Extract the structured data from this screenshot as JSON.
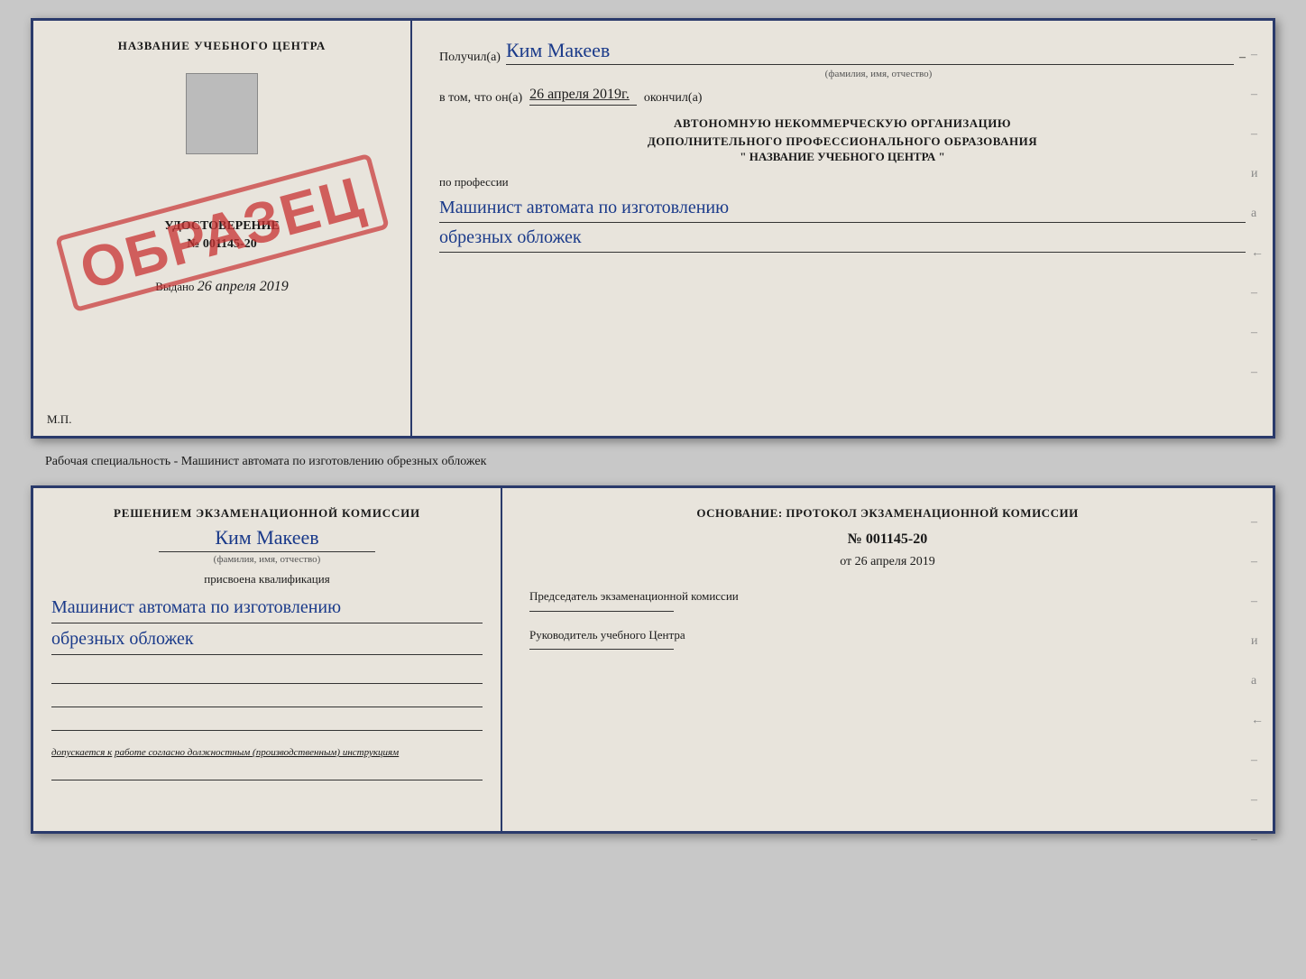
{
  "top_doc": {
    "left": {
      "training_center": "НАЗВАНИЕ УЧЕБНОГО ЦЕНТРА",
      "stamp_text": "ОБРАЗЕЦ",
      "certificate_label": "УДОСТОВЕРЕНИЕ",
      "cert_number": "№ 001145-20",
      "vydano_label": "Выдано",
      "vydano_date": "26 апреля 2019",
      "mp_label": "М.П."
    },
    "right": {
      "poluchil_label": "Получил(а)",
      "recipient_name": "Ким Макеев",
      "fio_subtitle": "(фамилия, имя, отчество)",
      "dash": "–",
      "vtom_label": "в том, что он(а)",
      "date_value": "26 апреля 2019г.",
      "okonchil_label": "окончил(а)",
      "org_line1": "АВТОНОМНУЮ НЕКОММЕРЧЕСКУЮ ОРГАНИЗАЦИЮ",
      "org_line2": "ДОПОЛНИТЕЛЬНОГО ПРОФЕССИОНАЛЬНОГО ОБРАЗОВАНИЯ",
      "org_name": "\"   НАЗВАНИЕ УЧЕБНОГО ЦЕНТРА   \"",
      "po_professii": "по профессии",
      "profession_line1": "Машинист автомата по изготовлению",
      "profession_line2": "обрезных обложек",
      "side_dashes": [
        "–",
        "–",
        "–",
        "и",
        "а",
        "←",
        "–",
        "–",
        "–"
      ]
    }
  },
  "separator": {
    "text": "Рабочая специальность - Машинист автомата по изготовлению обрезных обложек"
  },
  "bottom_doc": {
    "left": {
      "decision_text": "Решением экзаменационной комиссии",
      "name": "Ким Макеев",
      "fio_subtitle": "(фамилия, имя, отчество)",
      "prisvoena": "присвоена квалификация",
      "qual_line1": "Машинист автомата по изготовлению",
      "qual_line2": "обрезных обложек",
      "dopuskaetsya_label": "допускается к",
      "dopuskaetsya_text": "работе согласно должностным (производственным) инструкциям"
    },
    "right": {
      "osnovanie_text": "Основание: протокол экзаменационной комиссии",
      "protocol_number": "№  001145-20",
      "ot_label": "от",
      "ot_date": "26 апреля 2019",
      "chairman_label": "Председатель экзаменационной комиссии",
      "director_label": "Руководитель учебного Центра",
      "side_dashes": [
        "–",
        "–",
        "–",
        "и",
        "а",
        "←",
        "–",
        "–",
        "–"
      ]
    }
  }
}
